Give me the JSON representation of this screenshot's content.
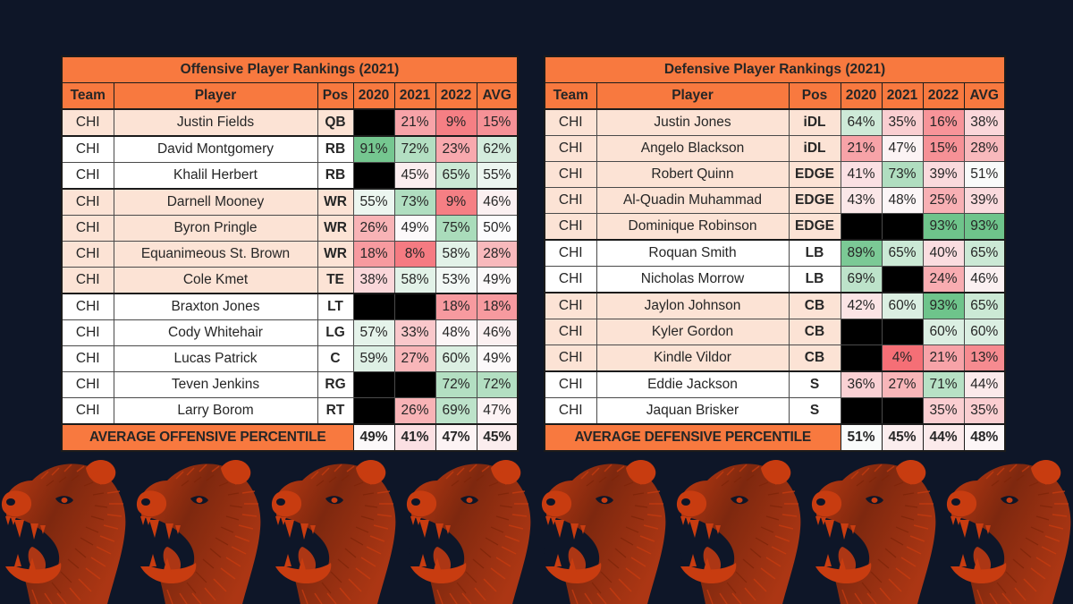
{
  "background_color": "#0e1628",
  "accent_color": "#f8793f",
  "colors": {
    "header_orange": "#f8793f",
    "band_peach": "#fce3d5",
    "band_white": "#ffffff",
    "blank_black": "#000000",
    "high_green": "#57bb78",
    "low_red": "#f4636a",
    "mid_white": "#fcfcfd",
    "bear_orange": "#c83c10",
    "text_dark": "#262626"
  },
  "columns": [
    "Team",
    "Player",
    "Pos",
    "2020",
    "2021",
    "2022",
    "AVG"
  ],
  "offense": {
    "title": "Offensive Player Rankings (2021)",
    "headers": [
      "Team",
      "Player",
      "Pos",
      "2020",
      "2021",
      "2022",
      "AVG"
    ],
    "rows": [
      {
        "team": "CHI",
        "player": "Justin Fields",
        "pos": "QB",
        "y2020": "",
        "y2021": "21%",
        "y2022": "9%",
        "avg": "15%",
        "band": "peach",
        "group_start": true
      },
      {
        "team": "CHI",
        "player": "David Montgomery",
        "pos": "RB",
        "y2020": "91%",
        "y2021": "72%",
        "y2022": "23%",
        "avg": "62%",
        "band": "white",
        "group_start": true
      },
      {
        "team": "CHI",
        "player": "Khalil Herbert",
        "pos": "RB",
        "y2020": "",
        "y2021": "45%",
        "y2022": "65%",
        "avg": "55%",
        "band": "white",
        "group_start": false
      },
      {
        "team": "CHI",
        "player": "Darnell Mooney",
        "pos": "WR",
        "y2020": "55%",
        "y2021": "73%",
        "y2022": "9%",
        "avg": "46%",
        "band": "peach",
        "group_start": true
      },
      {
        "team": "CHI",
        "player": "Byron Pringle",
        "pos": "WR",
        "y2020": "26%",
        "y2021": "49%",
        "y2022": "75%",
        "avg": "50%",
        "band": "peach",
        "group_start": false
      },
      {
        "team": "CHI",
        "player": "Equanimeous St. Brown",
        "pos": "WR",
        "y2020": "18%",
        "y2021": "8%",
        "y2022": "58%",
        "avg": "28%",
        "band": "peach",
        "group_start": false
      },
      {
        "team": "CHI",
        "player": "Cole Kmet",
        "pos": "TE",
        "y2020": "38%",
        "y2021": "58%",
        "y2022": "53%",
        "avg": "49%",
        "band": "peach",
        "group_start": false
      },
      {
        "team": "CHI",
        "player": "Braxton Jones",
        "pos": "LT",
        "y2020": "",
        "y2021": "",
        "y2022": "18%",
        "avg": "18%",
        "band": "white",
        "group_start": true
      },
      {
        "team": "CHI",
        "player": "Cody Whitehair",
        "pos": "LG",
        "y2020": "57%",
        "y2021": "33%",
        "y2022": "48%",
        "avg": "46%",
        "band": "white",
        "group_start": false
      },
      {
        "team": "CHI",
        "player": "Lucas Patrick",
        "pos": "C",
        "y2020": "59%",
        "y2021": "27%",
        "y2022": "60%",
        "avg": "49%",
        "band": "white",
        "group_start": false
      },
      {
        "team": "CHI",
        "player": "Teven Jenkins",
        "pos": "RG",
        "y2020": "",
        "y2021": "",
        "y2022": "72%",
        "avg": "72%",
        "band": "white",
        "group_start": false
      },
      {
        "team": "CHI",
        "player": "Larry Borom",
        "pos": "RT",
        "y2020": "",
        "y2021": "26%",
        "y2022": "69%",
        "avg": "47%",
        "band": "white",
        "group_start": false
      }
    ],
    "average_label": "AVERAGE OFFENSIVE PERCENTILE",
    "averages": [
      "49%",
      "41%",
      "47%",
      "45%"
    ]
  },
  "defense": {
    "title": "Defensive Player Rankings (2021)",
    "headers": [
      "Team",
      "Player",
      "Pos",
      "2020",
      "2021",
      "2022",
      "AVG"
    ],
    "rows": [
      {
        "team": "CHI",
        "player": "Justin Jones",
        "pos": "iDL",
        "y2020": "64%",
        "y2021": "35%",
        "y2022": "16%",
        "avg": "38%",
        "band": "peach",
        "group_start": true
      },
      {
        "team": "CHI",
        "player": "Angelo Blackson",
        "pos": "iDL",
        "y2020": "21%",
        "y2021": "47%",
        "y2022": "15%",
        "avg": "28%",
        "band": "peach",
        "group_start": false
      },
      {
        "team": "CHI",
        "player": "Robert Quinn",
        "pos": "EDGE",
        "y2020": "41%",
        "y2021": "73%",
        "y2022": "39%",
        "avg": "51%",
        "band": "peach",
        "group_start": false
      },
      {
        "team": "CHI",
        "player": "Al-Quadin Muhammad",
        "pos": "EDGE",
        "y2020": "43%",
        "y2021": "48%",
        "y2022": "25%",
        "avg": "39%",
        "band": "peach",
        "group_start": false
      },
      {
        "team": "CHI",
        "player": "Dominique Robinson",
        "pos": "EDGE",
        "y2020": "",
        "y2021": "",
        "y2022": "93%",
        "avg": "93%",
        "band": "peach",
        "group_start": false
      },
      {
        "team": "CHI",
        "player": "Roquan Smith",
        "pos": "LB",
        "y2020": "89%",
        "y2021": "65%",
        "y2022": "40%",
        "avg": "65%",
        "band": "white",
        "group_start": true
      },
      {
        "team": "CHI",
        "player": "Nicholas Morrow",
        "pos": "LB",
        "y2020": "69%",
        "y2021": "",
        "y2022": "24%",
        "avg": "46%",
        "band": "white",
        "group_start": false
      },
      {
        "team": "CHI",
        "player": "Jaylon Johnson",
        "pos": "CB",
        "y2020": "42%",
        "y2021": "60%",
        "y2022": "93%",
        "avg": "65%",
        "band": "peach",
        "group_start": true
      },
      {
        "team": "CHI",
        "player": "Kyler Gordon",
        "pos": "CB",
        "y2020": "",
        "y2021": "",
        "y2022": "60%",
        "avg": "60%",
        "band": "peach",
        "group_start": false
      },
      {
        "team": "CHI",
        "player": "Kindle Vildor",
        "pos": "CB",
        "y2020": "",
        "y2021": "4%",
        "y2022": "21%",
        "avg": "13%",
        "band": "peach",
        "group_start": false
      },
      {
        "team": "CHI",
        "player": "Eddie Jackson",
        "pos": "S",
        "y2020": "36%",
        "y2021": "27%",
        "y2022": "71%",
        "avg": "44%",
        "band": "white",
        "group_start": true
      },
      {
        "team": "CHI",
        "player": "Jaquan Brisker",
        "pos": "S",
        "y2020": "",
        "y2021": "",
        "y2022": "35%",
        "avg": "35%",
        "band": "white",
        "group_start": false
      }
    ],
    "average_label": "AVERAGE DEFENSIVE PERCENTILE",
    "averages": [
      "51%",
      "45%",
      "44%",
      "48%"
    ]
  },
  "footer_graphic": {
    "name": "bear-head-pattern",
    "tile_count": 8,
    "color": "#c83c10"
  }
}
